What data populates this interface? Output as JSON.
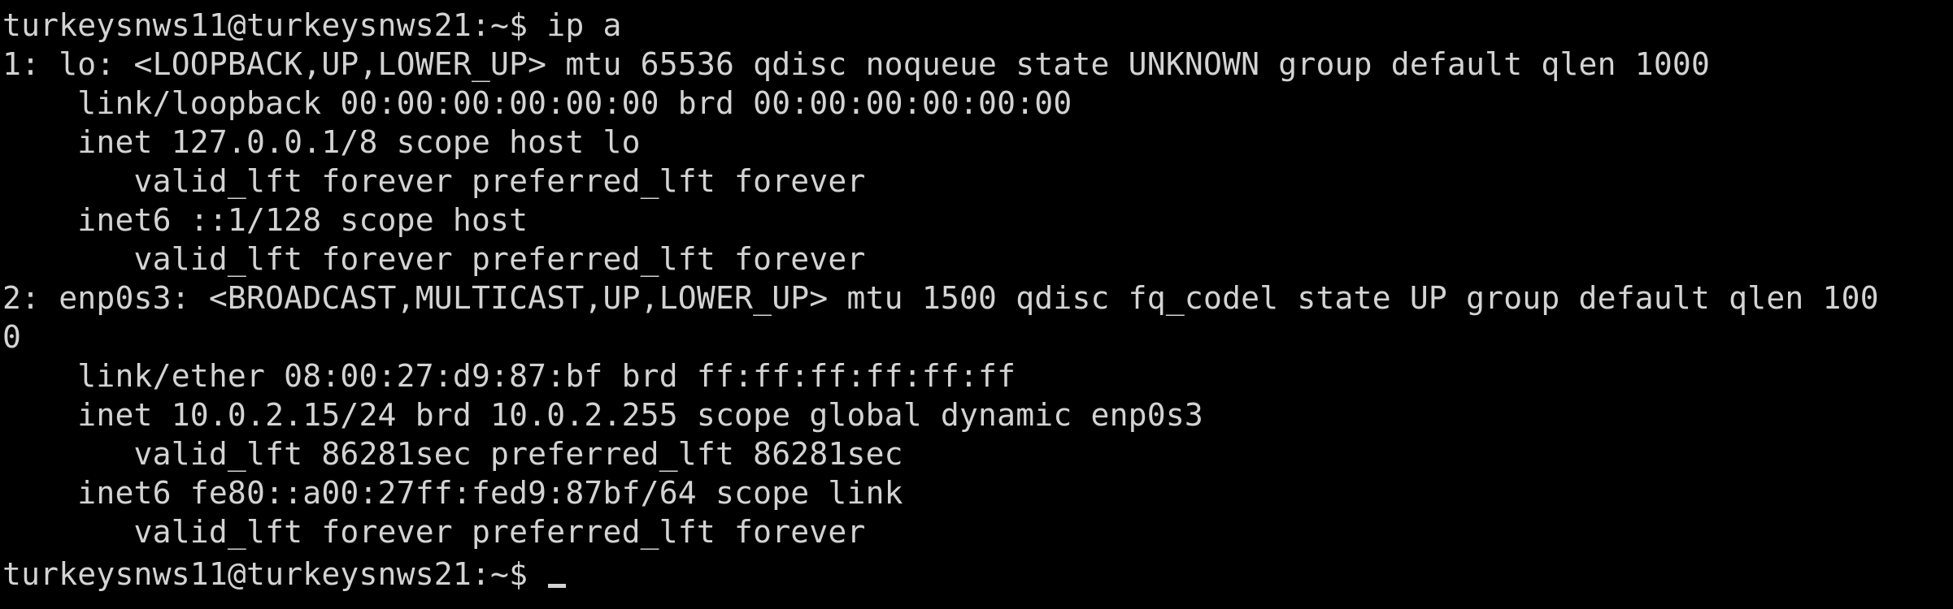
{
  "terminal": {
    "background": "#000000",
    "foreground": "#d3d3d3",
    "lines": [
      "turkeysnws11@turkeysnws21:~$ ip a",
      "1: lo: <LOOPBACK,UP,LOWER_UP> mtu 65536 qdisc noqueue state UNKNOWN group default qlen 1000",
      "    link/loopback 00:00:00:00:00:00 brd 00:00:00:00:00:00",
      "    inet 127.0.0.1/8 scope host lo",
      "       valid_lft forever preferred_lft forever",
      "    inet6 ::1/128 scope host",
      "       valid_lft forever preferred_lft forever",
      "2: enp0s3: <BROADCAST,MULTICAST,UP,LOWER_UP> mtu 1500 qdisc fq_codel state UP group default qlen 100",
      "0",
      "    link/ether 08:00:27:d9:87:bf brd ff:ff:ff:ff:ff:ff",
      "    inet 10.0.2.15/24 brd 10.0.2.255 scope global dynamic enp0s3",
      "       valid_lft 86281sec preferred_lft 86281sec",
      "    inet6 fe80::a00:27ff:fed9:87bf/64 scope link",
      "       valid_lft forever preferred_lft forever"
    ],
    "prompt": "turkeysnws11@turkeysnws21:~$ "
  }
}
